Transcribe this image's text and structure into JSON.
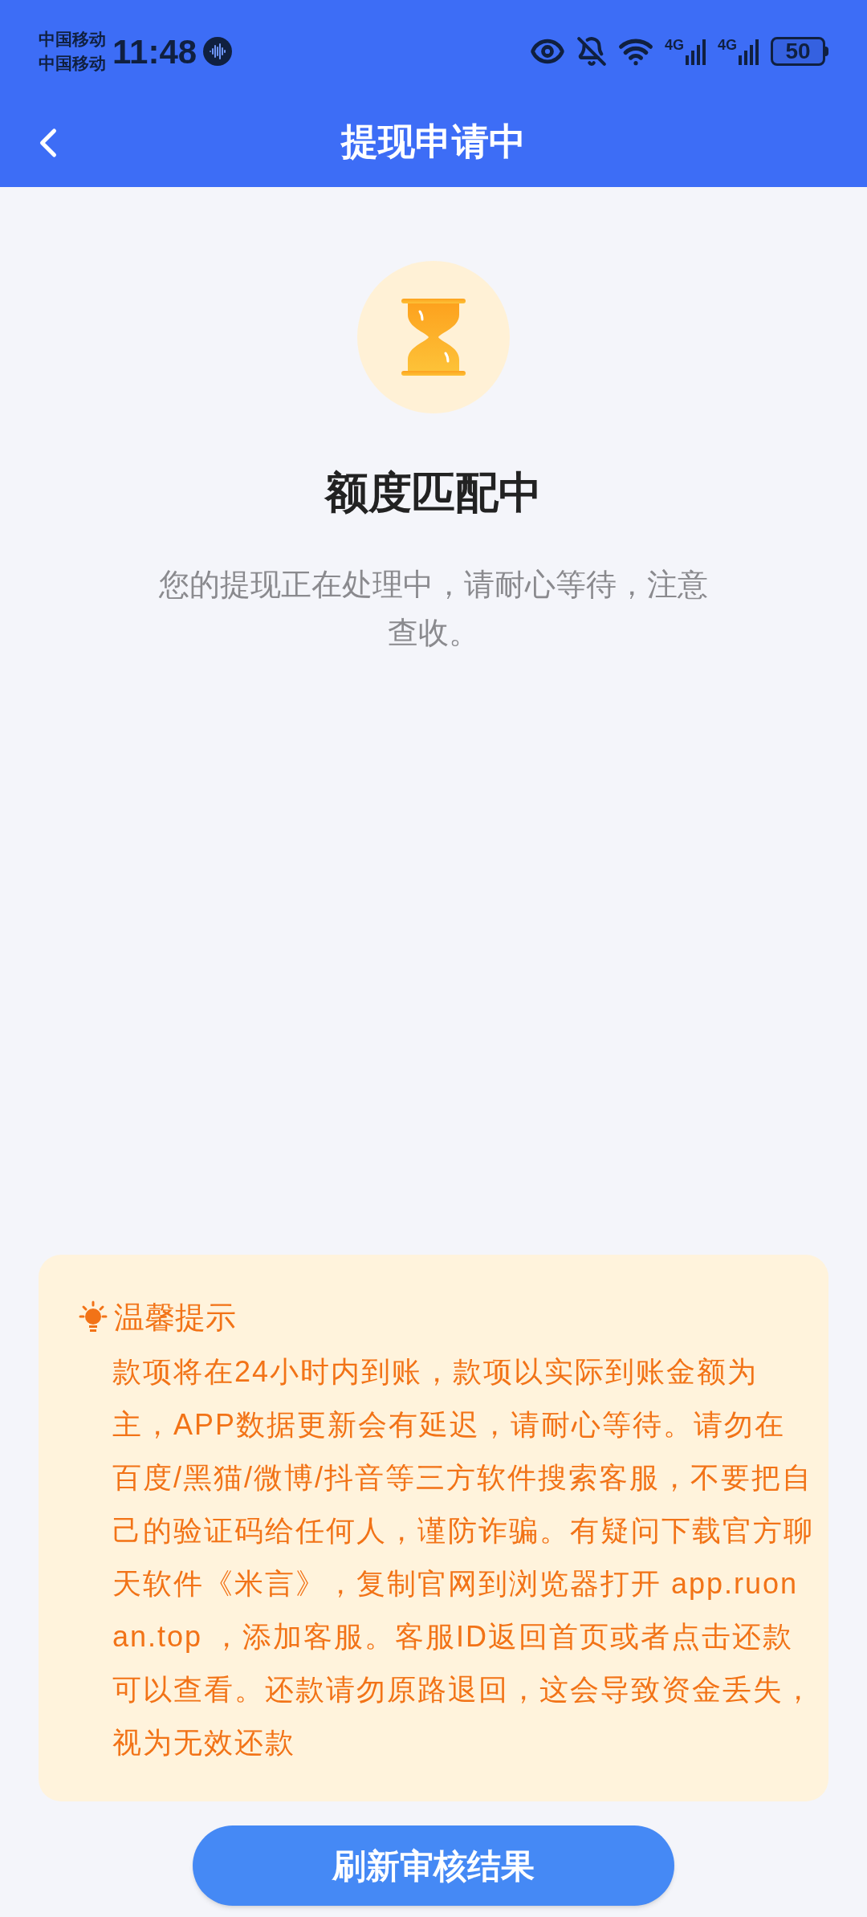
{
  "status_bar": {
    "carriers": [
      "中国移动",
      "中国移动"
    ],
    "time": "11:48",
    "network_labels": [
      "4G",
      "4G"
    ],
    "battery": "50"
  },
  "header": {
    "title": "提现申请中"
  },
  "status": {
    "title": "额度匹配中",
    "description": "您的提现正在处理中，请耐心等待，注意查收。"
  },
  "tip": {
    "title": "温馨提示",
    "body": "款项将在24小时内到账，款项以实际到账金额为主，APP数据更新会有延迟，请耐心等待。请勿在百度/黑猫/微博/抖音等三方软件搜索客服，不要把自己的验证码给任何人，谨防诈骗。有疑问下载官方聊天软件《米言》，复制官网到浏览器打开 app.ruonan.top ，添加客服。客服ID返回首页或者点击还款可以查看。还款请勿原路退回，这会导致资金丢失，视为无效还款"
  },
  "button": {
    "label": "刷新审核结果"
  }
}
